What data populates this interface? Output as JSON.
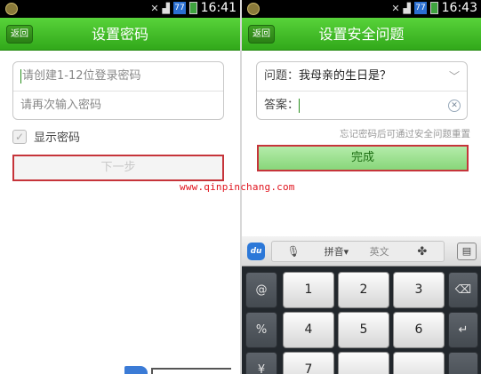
{
  "left_screen": {
    "status": {
      "time": "16:41",
      "sim_badge": "77"
    },
    "back_label": "返回",
    "title": "设置密码",
    "password_placeholder": "请创建1-12位登录密码",
    "confirm_placeholder": "请再次输入密码",
    "show_password_label": "显示密码",
    "next_label": "下一步"
  },
  "right_screen": {
    "status": {
      "time": "16:43",
      "sim_badge": "77"
    },
    "back_label": "返回",
    "title": "设置安全问题",
    "question_label": "问题：",
    "question_value": "我母亲的生日是？",
    "answer_label": "答案：",
    "hint": "忘记密码后可通过安全问题重置",
    "done_label": "完成",
    "keyboard": {
      "brand": "du",
      "pinyin_label": "拼音▾",
      "english_label": "英文",
      "keys_row1": [
        "@",
        "1",
        "2",
        "3"
      ],
      "keys_row2": [
        "%",
        "4",
        "5",
        "6"
      ],
      "keys_row3": [
        "¥",
        "7"
      ]
    }
  },
  "watermark": "www.qinpinchang.com",
  "colors": {
    "header_green": "#3fbb22",
    "highlight_border": "#c6343a",
    "watermark_red": "#e0141e"
  }
}
